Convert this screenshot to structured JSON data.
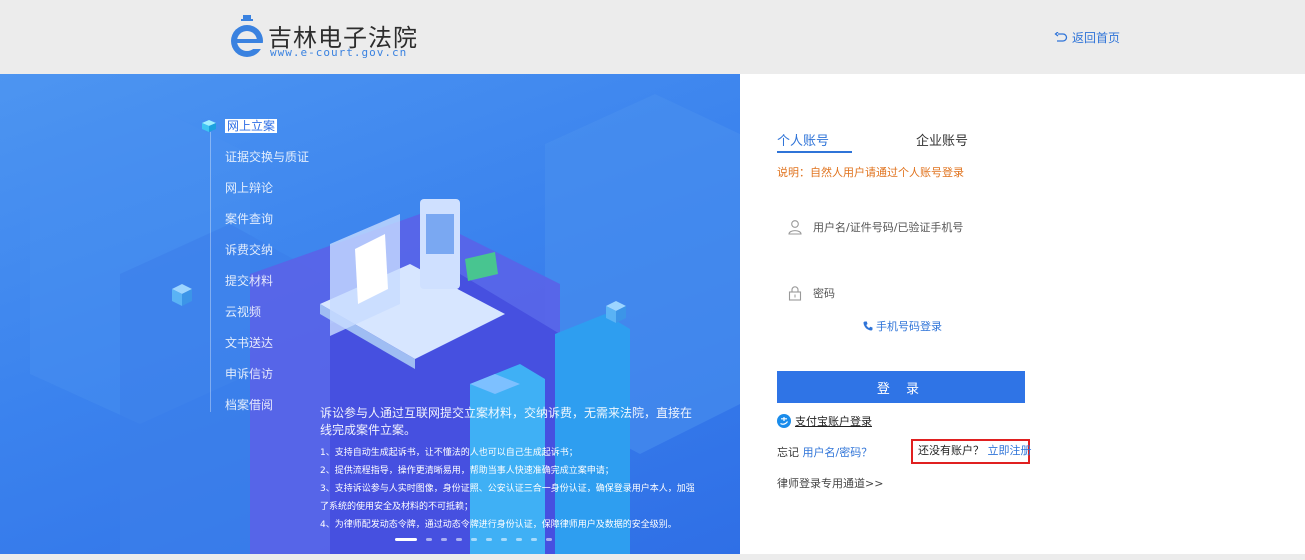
{
  "header": {
    "site_title": "吉林电子法院",
    "site_url": "www.e-court.gov.cn",
    "home_link": "返回首页"
  },
  "banner": {
    "menu": [
      {
        "label": "网上立案",
        "active": true
      },
      {
        "label": "证据交换与质证"
      },
      {
        "label": "网上辩论"
      },
      {
        "label": "案件查询"
      },
      {
        "label": "诉费交纳"
      },
      {
        "label": "提交材料"
      },
      {
        "label": "云视频"
      },
      {
        "label": "文书送达"
      },
      {
        "label": "申诉信访"
      },
      {
        "label": "档案借阅"
      }
    ],
    "intro": "诉讼参与人通过互联网提交立案材料，交纳诉费，无需来法院，直接在线完成案件立案。",
    "points": [
      "1、支持自动生成起诉书，让不懂法的人也可以自己生成起诉书；",
      "2、提供流程指导，操作更清晰易用，帮助当事人快速准确完成立案申请；",
      "3、支持诉讼参与人实时图像，身份证照、公安认证三合一身份认证，确保登录用户本人，加强了系统的使用安全及材料的不可抵赖；",
      "4、为律师配发动态令牌，通过动态令牌进行身份认证，保障律师用户及数据的安全级别。"
    ],
    "carousel_total": 10,
    "carousel_active": 1
  },
  "login": {
    "tabs": [
      "个人账号",
      "企业账号"
    ],
    "active_tab": 0,
    "note": "说明：自然人用户请通过个人账号登录",
    "username_placeholder": "用户名/证件号码/已验证手机号",
    "password_placeholder": "密码",
    "phone_login": "手机号码登录",
    "submit": "登 录",
    "alipay": "支付宝账户登录",
    "forgot_prefix": "忘记",
    "forgot_link": "用户名/密码？",
    "register_prefix": "还没有账户？",
    "register_link": "立即注册",
    "lawyer": "律师登录专用通道>>"
  },
  "colors": {
    "brand_blue": "#2f74e6",
    "note_orange": "#e0731e",
    "highlight_red": "#e02020"
  }
}
